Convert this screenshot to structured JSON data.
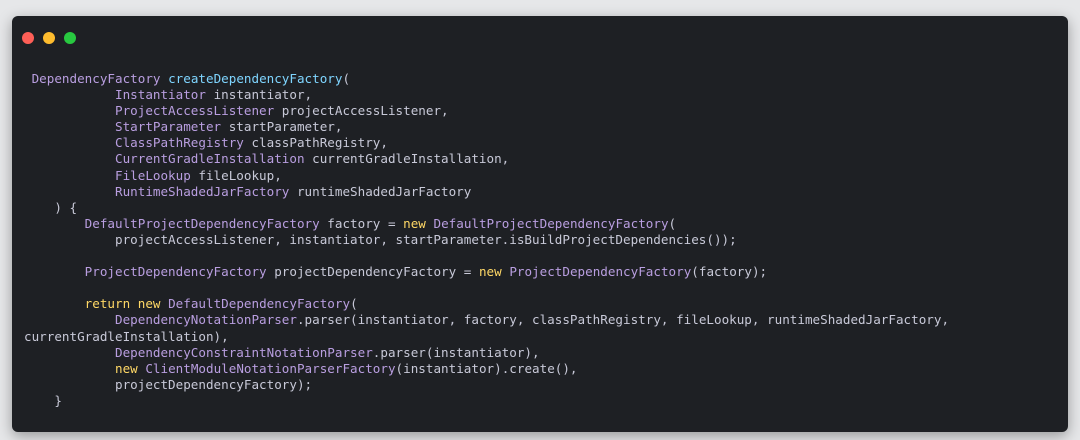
{
  "window": {
    "traffic_lights": [
      {
        "name": "close",
        "color": "#fe5f57"
      },
      {
        "name": "minimize",
        "color": "#febc2e"
      },
      {
        "name": "maximize",
        "color": "#28c840"
      }
    ]
  },
  "colors": {
    "background": "#1e2024",
    "type": "#b99ee0",
    "function": "#7fd5ff",
    "keyword": "#ffd866",
    "plain": "#c8c9d8"
  },
  "code_lines": [
    [
      {
        "c": "type",
        "t": " DependencyFactory"
      },
      {
        "c": "ident",
        "t": " "
      },
      {
        "c": "func",
        "t": "createDependencyFactory"
      },
      {
        "c": "punc",
        "t": "("
      }
    ],
    [
      {
        "c": "type",
        "t": "            Instantiator"
      },
      {
        "c": "ident",
        "t": " instantiator,"
      }
    ],
    [
      {
        "c": "type",
        "t": "            ProjectAccessListener"
      },
      {
        "c": "ident",
        "t": " projectAccessListener,"
      }
    ],
    [
      {
        "c": "type",
        "t": "            StartParameter"
      },
      {
        "c": "ident",
        "t": " startParameter,"
      }
    ],
    [
      {
        "c": "type",
        "t": "            ClassPathRegistry"
      },
      {
        "c": "ident",
        "t": " classPathRegistry,"
      }
    ],
    [
      {
        "c": "type",
        "t": "            CurrentGradleInstallation"
      },
      {
        "c": "ident",
        "t": " currentGradleInstallation,"
      }
    ],
    [
      {
        "c": "type",
        "t": "            FileLookup"
      },
      {
        "c": "ident",
        "t": " fileLookup,"
      }
    ],
    [
      {
        "c": "type",
        "t": "            RuntimeShadedJarFactory"
      },
      {
        "c": "ident",
        "t": " runtimeShadedJarFactory"
      }
    ],
    [
      {
        "c": "punc",
        "t": "    ) {"
      }
    ],
    [
      {
        "c": "type",
        "t": "        DefaultProjectDependencyFactory"
      },
      {
        "c": "ident",
        "t": " factory "
      },
      {
        "c": "punc",
        "t": "="
      },
      {
        "c": "ident",
        "t": " "
      },
      {
        "c": "kw",
        "t": "new"
      },
      {
        "c": "ident",
        "t": " "
      },
      {
        "c": "type",
        "t": "DefaultProjectDependencyFactory"
      },
      {
        "c": "punc",
        "t": "("
      }
    ],
    [
      {
        "c": "ident",
        "t": "            projectAccessListener, instantiator, startParameter.isBuildProjectDependencies());"
      }
    ],
    [
      {
        "c": "ident",
        "t": ""
      }
    ],
    [
      {
        "c": "type",
        "t": "        ProjectDependencyFactory"
      },
      {
        "c": "ident",
        "t": " projectDependencyFactory "
      },
      {
        "c": "punc",
        "t": "="
      },
      {
        "c": "ident",
        "t": " "
      },
      {
        "c": "kw",
        "t": "new"
      },
      {
        "c": "ident",
        "t": " "
      },
      {
        "c": "type",
        "t": "ProjectDependencyFactory"
      },
      {
        "c": "punc",
        "t": "(factory);"
      }
    ],
    [
      {
        "c": "ident",
        "t": ""
      }
    ],
    [
      {
        "c": "kw",
        "t": "        return new"
      },
      {
        "c": "ident",
        "t": " "
      },
      {
        "c": "type",
        "t": "DefaultDependencyFactory"
      },
      {
        "c": "punc",
        "t": "("
      }
    ],
    [
      {
        "c": "type",
        "t": "            DependencyNotationParser"
      },
      {
        "c": "ident",
        "t": ".parser(instantiator, factory, classPathRegistry, fileLookup, runtimeShadedJarFactory,"
      }
    ],
    [
      {
        "c": "ident",
        "t": "currentGradleInstallation),"
      }
    ],
    [
      {
        "c": "type",
        "t": "            DependencyConstraintNotationParser"
      },
      {
        "c": "ident",
        "t": ".parser(instantiator),"
      }
    ],
    [
      {
        "c": "kw",
        "t": "            new"
      },
      {
        "c": "ident",
        "t": " "
      },
      {
        "c": "type",
        "t": "ClientModuleNotationParserFactory"
      },
      {
        "c": "ident",
        "t": "(instantiator).create(),"
      }
    ],
    [
      {
        "c": "ident",
        "t": "            projectDependencyFactory);"
      }
    ],
    [
      {
        "c": "punc",
        "t": "    }"
      }
    ]
  ]
}
